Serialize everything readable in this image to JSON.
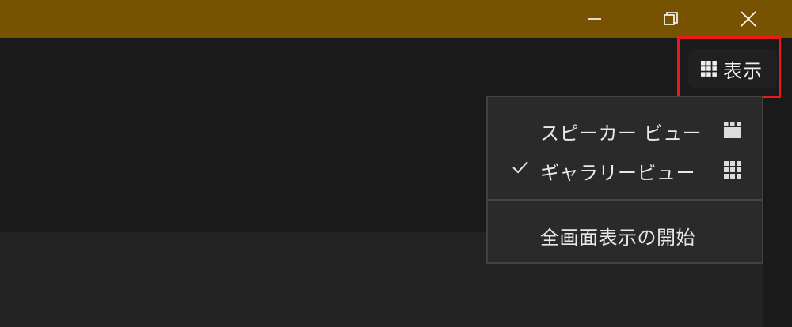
{
  "window": {
    "title_bar_color": "#775200",
    "controls": [
      {
        "name": "minimize",
        "icon": "minimize-icon"
      },
      {
        "name": "restore",
        "icon": "restore-icon"
      },
      {
        "name": "close",
        "icon": "close-icon"
      }
    ]
  },
  "toolbar": {
    "view_button": {
      "label": "表示",
      "icon": "grid-icon",
      "highlighted": true,
      "highlight_color": "#e61c1c"
    }
  },
  "view_menu": {
    "items": [
      {
        "label": "スピーカー ビュー",
        "checked": false,
        "icon": "speaker-view-icon"
      },
      {
        "label": "ギャラリービュー",
        "checked": true,
        "icon": "gallery-view-icon"
      }
    ],
    "fullscreen_label": "全画面表示の開始"
  }
}
